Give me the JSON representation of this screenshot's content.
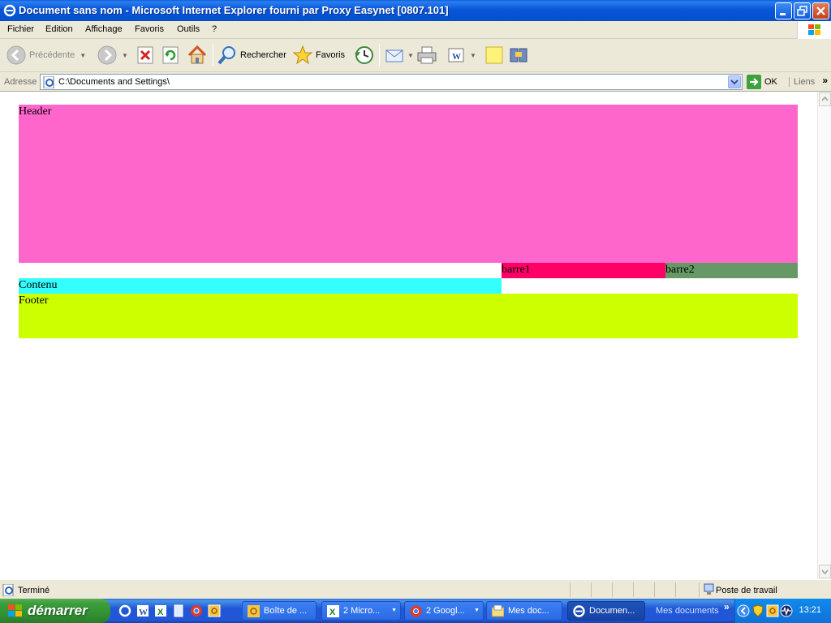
{
  "window": {
    "title": "Document sans nom - Microsoft Internet Explorer fourni par Proxy Easynet [0807.101]"
  },
  "menu": {
    "items": [
      "Fichier",
      "Edition",
      "Affichage",
      "Favoris",
      "Outils",
      "?"
    ]
  },
  "toolbar": {
    "back_label": "Précédente",
    "search_label": "Rechercher",
    "favorites_label": "Favoris"
  },
  "address": {
    "label": "Adresse",
    "value": "C:\\Documents and Settings\\",
    "go_label": "OK",
    "links_label": "Liens"
  },
  "page": {
    "header": "Header",
    "barre1": "barre1",
    "barre2": "barre2",
    "contenu": "Contenu",
    "footer": "Footer",
    "colors": {
      "header": "#ff66cc",
      "barre1": "#ff0066",
      "barre2": "#669966",
      "contenu": "#33ffff",
      "footer": "#ccff00"
    }
  },
  "status": {
    "text": "Terminé",
    "zone": "Poste de travail"
  },
  "taskbar": {
    "start_label": "démarrer",
    "tasks": [
      {
        "label": "Boîte de ..."
      },
      {
        "label": "2 Micro..."
      },
      {
        "label": "2 Googl..."
      },
      {
        "label": "Mes doc..."
      },
      {
        "label": "Documen..."
      }
    ],
    "toolbar_label": "Mes documents",
    "clock": "13:21"
  }
}
